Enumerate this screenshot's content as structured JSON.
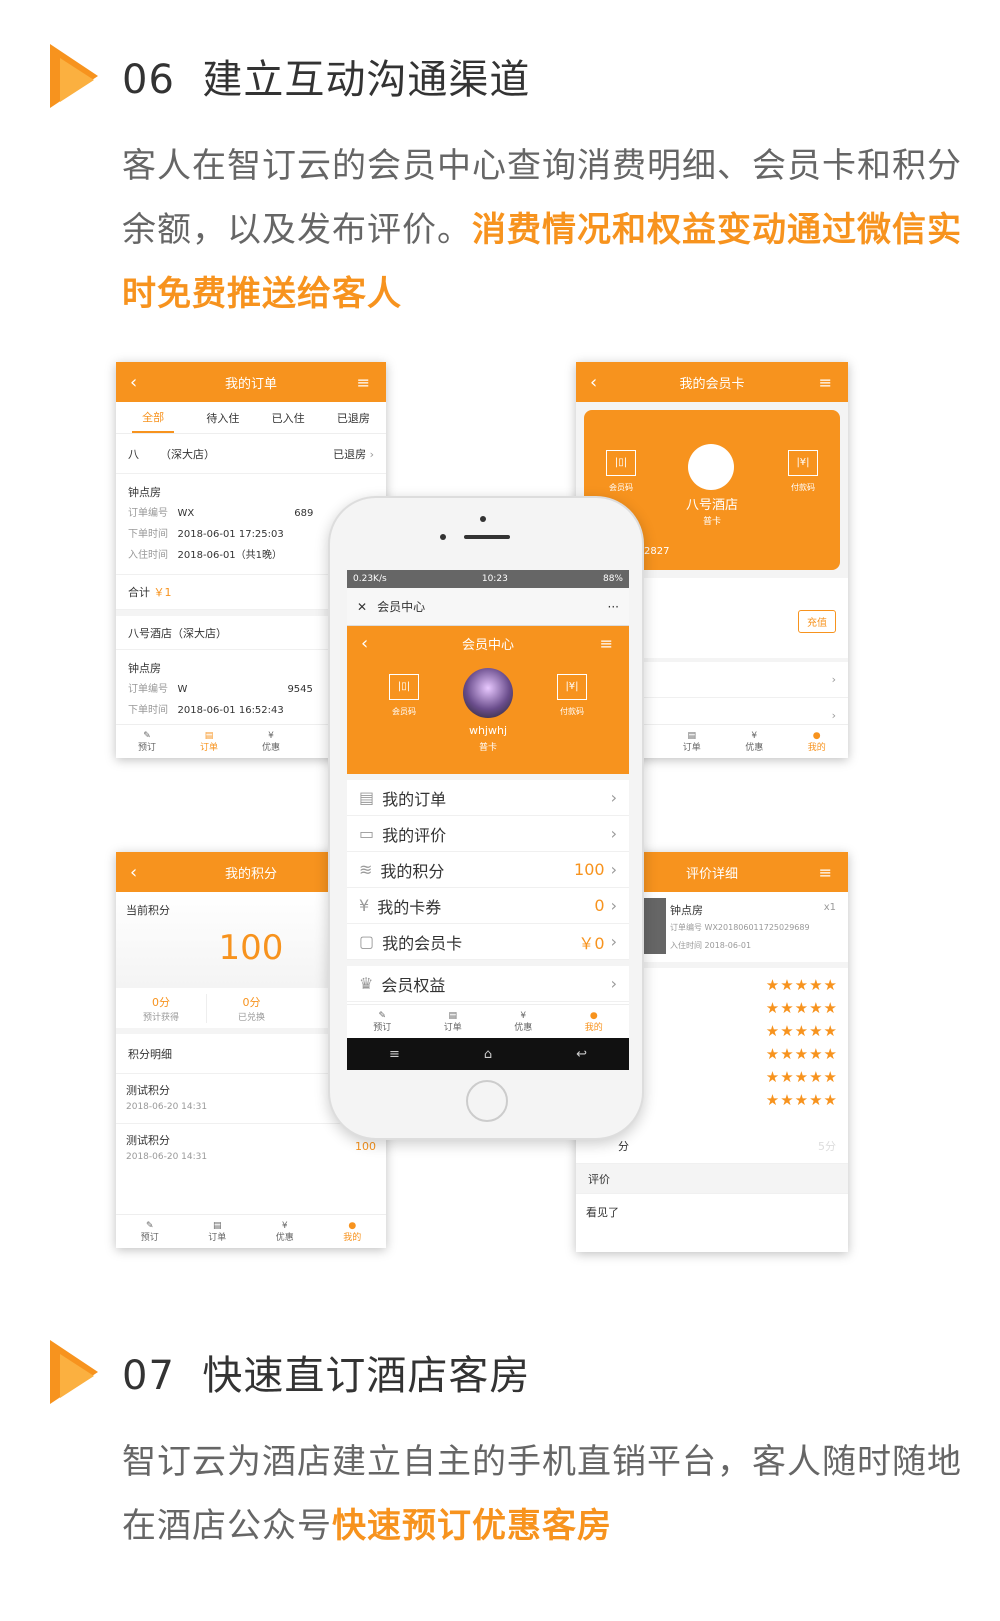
{
  "section06": {
    "num": "06",
    "title": "建立互动沟通渠道",
    "p_plain": "客人在智订云的会员中心查询消费明细、会员卡和积分余额，以及发布评价。",
    "p_hl": "消费情况和权益变动通过微信实时免费推送给客人"
  },
  "section07": {
    "num": "07",
    "title": "快速直订酒店客房",
    "p_plain": "智订云为酒店建立自主的手机直销平台，客人随时随地在酒店公众号",
    "p_hl": "快速预订优惠客房"
  },
  "orders": {
    "title": "我的订单",
    "tabs": [
      "全部",
      "待入住",
      "已入住",
      "已退房"
    ],
    "o1": {
      "hotel": "八",
      "branch": "（深大店）",
      "status": "已退房",
      "room": "钟点房",
      "no_label": "订单编号",
      "no": "WX",
      "no_tail": "689",
      "time_label": "下单时间",
      "time": "2018-06-01 17:25:03",
      "in_label": "入住时间",
      "in": "2018-06-01（共1晚）",
      "total_label": "合计",
      "total": "￥1"
    },
    "o2": {
      "hotel": "八号酒店（深大店）",
      "room": "钟点房",
      "no_label": "订单编号",
      "no": "W",
      "no_tail": "9545",
      "time_label": "下单时间",
      "time": "2018-06-01 16:52:43"
    },
    "nav": [
      "预订",
      "订单",
      "优惠"
    ]
  },
  "card": {
    "title": "我的会员卡",
    "code": "会员码",
    "pay": "付款码",
    "hotel": "八号酒店",
    "tier": "普卡",
    "num": "2827",
    "recharge": "充值",
    "nav": [
      "订单",
      "优惠",
      "我的"
    ]
  },
  "points": {
    "title": "我的积分",
    "current_label": "当前积分",
    "value": "100",
    "s1": "0分",
    "s1_label": "预计获得",
    "s2": "0分",
    "s2_label": "已兑换",
    "detail": "积分明细",
    "items": [
      {
        "name": "测试积分",
        "date": "2018-06-20 14:31"
      },
      {
        "name": "测试积分",
        "date": "2018-06-20 14:31"
      }
    ],
    "side_val": "100",
    "nav": [
      "预订",
      "订单",
      "优惠",
      "我的"
    ]
  },
  "review": {
    "title": "评价详细",
    "room": "钟点房",
    "no": "订单编号 WX201806011725029689",
    "in": "入住时间 2018-06-01",
    "score_tail": "分",
    "score_right": "5分",
    "comment_label": "评价",
    "comment": "看见了",
    "qty": "x1"
  },
  "phone": {
    "status_left": "0.23K/s",
    "status_time": "10:23",
    "status_right": "88%",
    "wx_title": "会员中心",
    "app_title": "会员中心",
    "code": "会员码",
    "pay": "付款码",
    "user": "whjwhj",
    "tier": "普卡",
    "menu": [
      {
        "label": "我的订单",
        "value": "",
        "icon": "order-icon"
      },
      {
        "label": "我的评价",
        "value": "",
        "icon": "comment-icon"
      },
      {
        "label": "我的积分",
        "value": "100",
        "icon": "coins-icon"
      },
      {
        "label": "我的卡券",
        "value": "0",
        "icon": "coupon-icon"
      },
      {
        "label": "我的会员卡",
        "value": "￥0",
        "icon": "card-icon"
      }
    ],
    "rights": "会员权益",
    "nav": [
      "预订",
      "订单",
      "优惠",
      "我的"
    ]
  },
  "colors": {
    "accent": "#f7931e",
    "accent_light": "#fbb040"
  }
}
